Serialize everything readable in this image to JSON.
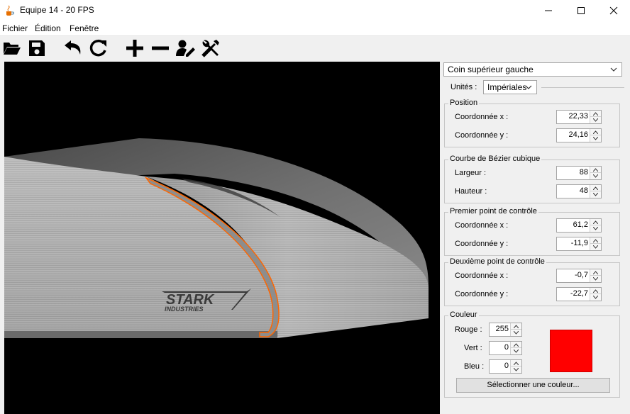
{
  "window": {
    "title": "Equipe 14 - 20 FPS",
    "icons": {
      "app": "java-cup-icon",
      "minimize": "minimize-icon",
      "maximize": "maximize-icon",
      "close": "close-icon"
    }
  },
  "menu": [
    "Fichier",
    "Édition",
    "Fenêtre"
  ],
  "toolbar": {
    "icons": [
      "open-folder-icon",
      "save-icon",
      "undo-icon",
      "redo-icon",
      "add-icon",
      "remove-icon",
      "edit-user-icon",
      "tools-icon"
    ]
  },
  "viewport": {
    "logo_line1": "STARK",
    "logo_line2": "INDUSTRIES",
    "colors": {
      "background": "#000000",
      "highlight": "#ff6600"
    }
  },
  "panel": {
    "corner_select": "Coin supérieur gauche",
    "units_label": "Unités :",
    "units_value": "Impériales",
    "position": {
      "title": "Position",
      "x_label": "Coordonnée x :",
      "x_value": "22,33",
      "y_label": "Coordonnée y :",
      "y_value": "24,16"
    },
    "bezier": {
      "title": "Courbe de Bézier cubique",
      "width_label": "Largeur :",
      "width_value": "88",
      "height_label": "Hauteur :",
      "height_value": "48"
    },
    "first_control": {
      "title": "Premier point de contrôle",
      "x_label": "Coordonnée x :",
      "x_value": "61,2",
      "y_label": "Coordonnée y :",
      "y_value": "-11,9"
    },
    "second_control": {
      "title": "Deuxième point de contrôle",
      "x_label": "Coordonnée x :",
      "x_value": "-0,7",
      "y_label": "Coordonnée y :",
      "y_value": "-22,7"
    },
    "color": {
      "title": "Couleur",
      "red_label": "Rouge :",
      "red_value": "255",
      "green_label": "Vert :",
      "green_value": "0",
      "blue_label": "Bleu :",
      "blue_value": "0",
      "swatch_color": "#ff0000",
      "select_button": "Sélectionner une couleur..."
    }
  }
}
